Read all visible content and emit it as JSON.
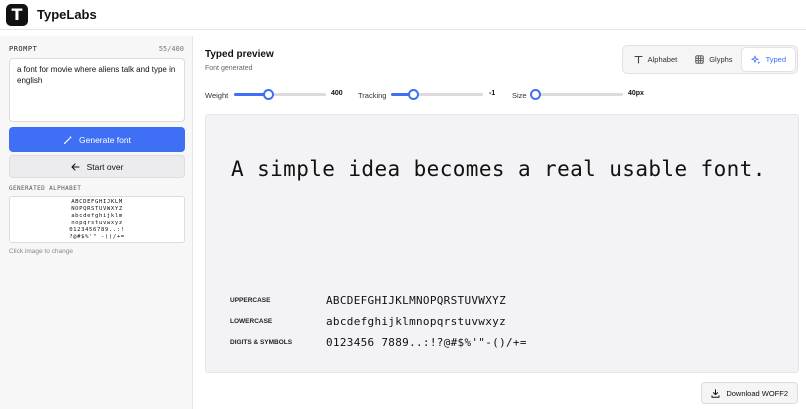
{
  "header": {
    "logo_letter": "T",
    "brand": "TypeLabs"
  },
  "sidebar": {
    "prompt_label": "PROMPT",
    "prompt_count": "55/400",
    "prompt_value": "a font for movie where aliens talk and type in english",
    "generate_label": "Generate font",
    "start_over_label": "Start over",
    "generated_alphabet_label": "GENERATED ALPHABET",
    "alphabet_lines": [
      "ABCDEFGHIJKLM",
      "NOPQRSTUVWXYZ",
      "abcdefghijklm",
      "nopqrstuvwxyz",
      "0123456789..:!",
      "?@#$%'\" -()/+="
    ],
    "click_hint": "Click image to change"
  },
  "main": {
    "title": "Typed preview",
    "subtitle": "Font generated",
    "tabs": [
      {
        "label": "Alphabet",
        "icon": "text-t-icon"
      },
      {
        "label": "Glyphs",
        "icon": "grid-icon"
      },
      {
        "label": "Typed",
        "icon": "sparkle-icon"
      }
    ],
    "active_tab": "Typed",
    "controls": {
      "weight": {
        "label": "Weight",
        "value": "400",
        "fraction": 0.38
      },
      "tracking": {
        "label": "Tracking",
        "value": "-1",
        "fraction": 0.24
      },
      "size": {
        "label": "Size",
        "value": "40px",
        "fraction": 0.0
      }
    },
    "sample_text": "A simple idea becomes a real usable font.",
    "rows": [
      {
        "label": "UPPERCASE",
        "text": "ABCDEFGHIJKLMNOPQRSTUVWXYZ"
      },
      {
        "label": "LOWERCASE",
        "text": "abcdefghijklmnopqrstuvwxyz"
      },
      {
        "label": "DIGITS & SYMBOLS",
        "text": "0123456 7889..:!?@#$%'\"-()/+="
      }
    ],
    "download_label": "Download WOFF2"
  },
  "colors": {
    "accent": "#3e6ff5",
    "dark": "#111111"
  }
}
